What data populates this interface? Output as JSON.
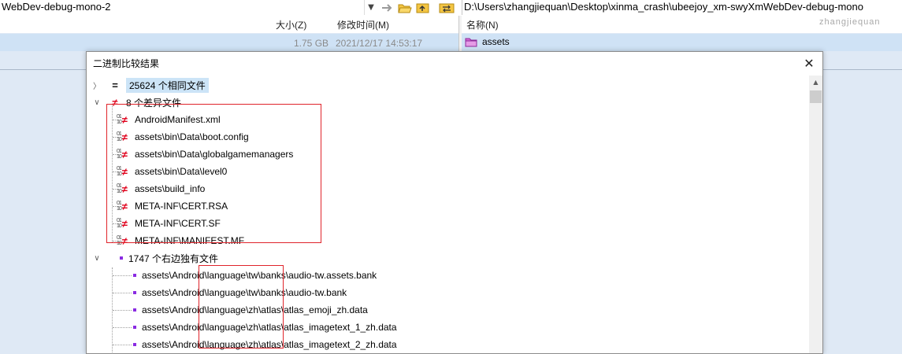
{
  "toolbar": {
    "left_path": "WebDev-debug-mono-2",
    "right_path": "D:\\Users\\zhangjiequan\\Desktop\\xinma_crash\\ubeejoy_xm-swyXmWebDev-debug-mono"
  },
  "left_panel": {
    "columns": {
      "size": "大小(Z)",
      "modified": "修改时间(M)"
    },
    "row": {
      "size": "1.75 GB",
      "modified": "2021/12/17 14:53:17"
    }
  },
  "right_panel": {
    "columns": {
      "name": "名称(N)"
    },
    "row": {
      "name": "assets"
    },
    "watermark": "zhangjiequan"
  },
  "dialog": {
    "title": "二进制比较结果",
    "close_symbol": "✕",
    "same_group": {
      "count": "25624",
      "label": "个相同文件"
    },
    "diff_group": {
      "count": "8",
      "label": "个差异文件",
      "files": [
        "AndroidManifest.xml",
        "assets\\bin\\Data\\boot.config",
        "assets\\bin\\Data\\globalgamemanagers",
        "assets\\bin\\Data\\level0",
        "assets\\build_info",
        "META-INF\\CERT.RSA",
        "META-INF\\CERT.SF",
        "META-INF\\MANIFEST.MF"
      ]
    },
    "right_only_group": {
      "count": "1747",
      "label": "个右边独有文件",
      "files": [
        "assets\\Android\\language\\tw\\banks\\audio-tw.assets.bank",
        "assets\\Android\\language\\tw\\banks\\audio-tw.bank",
        "assets\\Android\\language\\zh\\atlas\\atlas_emoji_zh.data",
        "assets\\Android\\language\\zh\\atlas\\atlas_imagetext_1_zh.data",
        "assets\\Android\\language\\zh\\atlas\\atlas_imagetext_2_zh.data"
      ]
    }
  },
  "colors": {
    "accent_red": "#e0001b",
    "purple": "#8a2be2",
    "selection": "#cce4f7",
    "annotation": "#e0242b"
  },
  "icons": {
    "same": "equals-icon",
    "different": "not-equal-icon",
    "right_only": "purple-square-icon"
  }
}
